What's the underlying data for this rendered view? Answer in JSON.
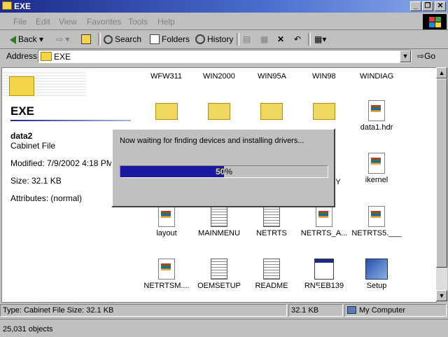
{
  "window": {
    "title": "EXE"
  },
  "menu": [
    "File",
    "Edit",
    "View",
    "Favorites",
    "Tools",
    "Help"
  ],
  "toolbar": {
    "back": "Back",
    "search": "Search",
    "folders": "Folders",
    "history": "History"
  },
  "address": {
    "label": "Address",
    "value": "EXE",
    "go": "Go"
  },
  "left_pane": {
    "folder_title": "EXE",
    "selected_name": "data2",
    "selected_type": "Cabinet File",
    "modified": "Modified: 7/9/2002 4:18 PM",
    "size": "Size: 32.1 KB",
    "attributes": "Attributes: (normal)"
  },
  "columns": [
    "WFW311",
    "WIN2000",
    "WIN95A",
    "WIN98",
    "WINDIAG"
  ],
  "files": [
    {
      "name": "data1.hdr",
      "kind": "doc-icon"
    },
    {
      "name": "ikernel",
      "kind": "doc-icon"
    },
    {
      "name": "Y",
      "kind": "doc-icon"
    },
    {
      "name": "layout",
      "kind": "doc-icon"
    },
    {
      "name": "MAINMENU",
      "kind": "text-icon"
    },
    {
      "name": "NETRTS",
      "kind": "text-icon"
    },
    {
      "name": "NETRTS_A...",
      "kind": "doc-icon"
    },
    {
      "name": "NETRTS5.___",
      "kind": "doc-icon"
    },
    {
      "name": "NETRTSM....",
      "kind": "doc-icon"
    },
    {
      "name": "OEMSETUP",
      "kind": "text-icon"
    },
    {
      "name": "README",
      "kind": "text-icon"
    },
    {
      "name": "RNEEB139",
      "kind": "app-icon"
    },
    {
      "name": "Setup",
      "kind": "setup-icon"
    }
  ],
  "status": {
    "left": "Type: Cabinet File Size: 32.1 KB",
    "size": "32.1 KB",
    "zone": "My Computer"
  },
  "object_count": "25,031 objects",
  "dialog": {
    "message": "Now waiting for finding devices and installing drivers...",
    "progress_percent": 50,
    "progress_label": "50%"
  },
  "colors": {
    "title_start": "#1c2a8a",
    "progress": "#1a1aa0"
  }
}
